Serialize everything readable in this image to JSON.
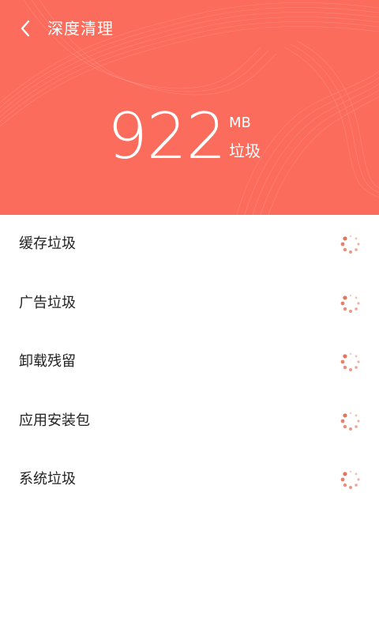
{
  "header": {
    "title": "深度清理",
    "back_icon": "chevron-left-icon",
    "size_value": "922",
    "size_unit": "MB",
    "size_label": "垃圾",
    "background_color": "#fc6c5d"
  },
  "scan_items": [
    {
      "label": "缓存垃圾",
      "status_icon": "loading-spinner-icon"
    },
    {
      "label": "广告垃圾",
      "status_icon": "loading-spinner-icon"
    },
    {
      "label": "卸载残留",
      "status_icon": "loading-spinner-icon"
    },
    {
      "label": "应用安装包",
      "status_icon": "loading-spinner-icon"
    },
    {
      "label": "系统垃圾",
      "status_icon": "loading-spinner-icon"
    }
  ],
  "colors": {
    "accent": "#fc6c5d",
    "spinner": "#e2694f",
    "text": "#222222"
  }
}
